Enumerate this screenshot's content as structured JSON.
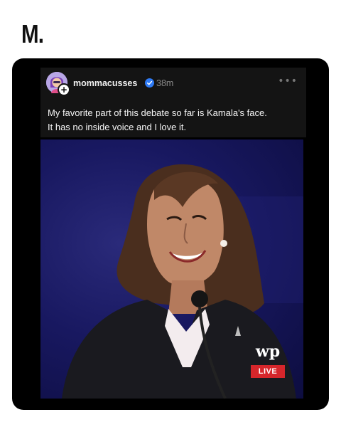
{
  "brand": {
    "logo_text": "M."
  },
  "post": {
    "username": "mommacusses",
    "timestamp": "38m",
    "more_icon": "more-horizontal-icon",
    "verified_icon": "verified-badge-icon",
    "text_line1": "My favorite part of this debate so far is Kamala's face.",
    "text_line2": "It has no inside voice and I love it."
  },
  "media": {
    "watermark": "wp",
    "live_label": "LIVE"
  },
  "colors": {
    "card_bg": "#000000",
    "post_bg": "#141414",
    "verified": "#2f7bf5",
    "live": "#d6262b",
    "stage_blue": "#1c1c66"
  }
}
